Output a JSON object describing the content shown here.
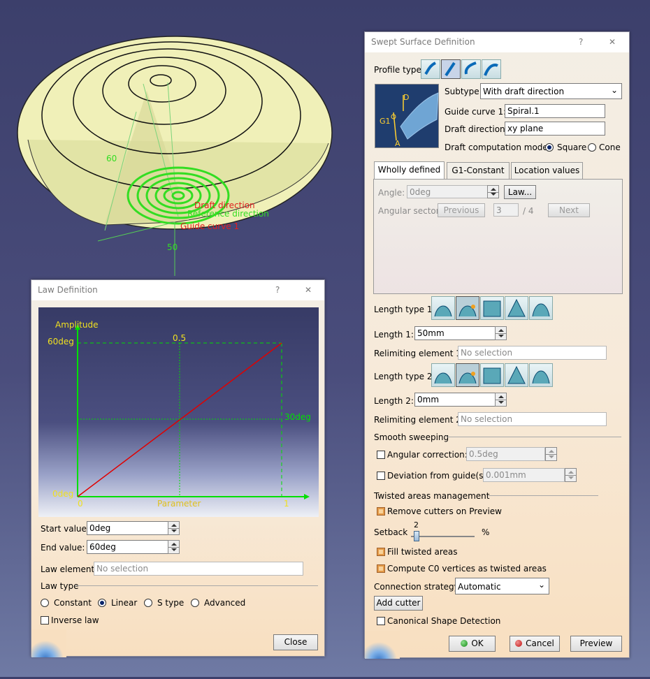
{
  "viewport": {
    "label_60": "60",
    "label_50": "50",
    "label_draft": "Draft direction",
    "label_ref": "Reference direction",
    "label_guide": "Guide curve 1"
  },
  "law": {
    "title": "Law Definition",
    "help": "?",
    "close_x": "✕",
    "plot": {
      "ylabel": "Amplitude",
      "xlabel": "Parameter",
      "y_top": "60deg",
      "y_bottom": "0deg",
      "y_mid": "30deg",
      "x_left": "0",
      "x_mid": "0.5",
      "x_right": "1"
    },
    "start_label": "Start value:",
    "start_value": "0deg",
    "end_label": "End value:",
    "end_value": "60deg",
    "element_label": "Law element:",
    "element_value": "No selection",
    "law_type_label": "Law type",
    "types": [
      "Constant",
      "Linear",
      "S type",
      "Advanced"
    ],
    "selected_type": "Linear",
    "inverse_label": "Inverse law",
    "close_button": "Close"
  },
  "swept": {
    "title": "Swept Surface Definition",
    "help": "?",
    "close_x": "✕",
    "profile_type_label": "Profile type:",
    "subtype_label": "Subtype:",
    "subtype_value": "With draft direction",
    "guide_label": "Guide curve 1:",
    "guide_value": "Spiral.1",
    "draft_label": "Draft direction:",
    "draft_value": "xy plane",
    "mode_label": "Draft computation mode:",
    "mode_square": "Square",
    "mode_cone": "Cone",
    "preview_labels": {
      "d": "D",
      "g1": "G1",
      "a": "A"
    },
    "tabs": [
      "Wholly defined",
      "G1-Constant",
      "Location values"
    ],
    "active_tab": "Wholly defined",
    "angle_label": "Angle:",
    "angle_value": "0deg",
    "law_button": "Law...",
    "sector_label": "Angular sector:",
    "previous_button": "Previous",
    "sector_value": "3",
    "sector_total": "/ 4",
    "next_button": "Next",
    "length_type1_label": "Length type 1:",
    "length1_label": "Length 1:",
    "length1_value": "50mm",
    "relim1_label": "Relimiting element 1:",
    "relim1_value": "No selection",
    "length_type2_label": "Length type 2:",
    "length2_label": "Length 2:",
    "length2_value": "0mm",
    "relim2_label": "Relimiting element 2:",
    "relim2_value": "No selection",
    "smooth_label": "Smooth sweeping",
    "angular_corr_label": "Angular correction:",
    "angular_corr_value": "0.5deg",
    "deviation_label": "Deviation from guide(s):",
    "deviation_value": "0.001mm",
    "twisted_label": "Twisted areas management",
    "remove_cutters_label": "Remove cutters on Preview",
    "setback_label": "Setback",
    "setback_value": "2",
    "setback_unit": "%",
    "setback_fraction": 0.02,
    "fill_label": "Fill twisted areas",
    "compute_label": "Compute C0 vertices as twisted areas",
    "connection_label": "Connection strategy:",
    "connection_value": "Automatic",
    "add_cutter_button": "Add cutter",
    "canonical_label": "Canonical Shape Detection",
    "ok_button": "OK",
    "cancel_button": "Cancel",
    "preview_button": "Preview"
  }
}
